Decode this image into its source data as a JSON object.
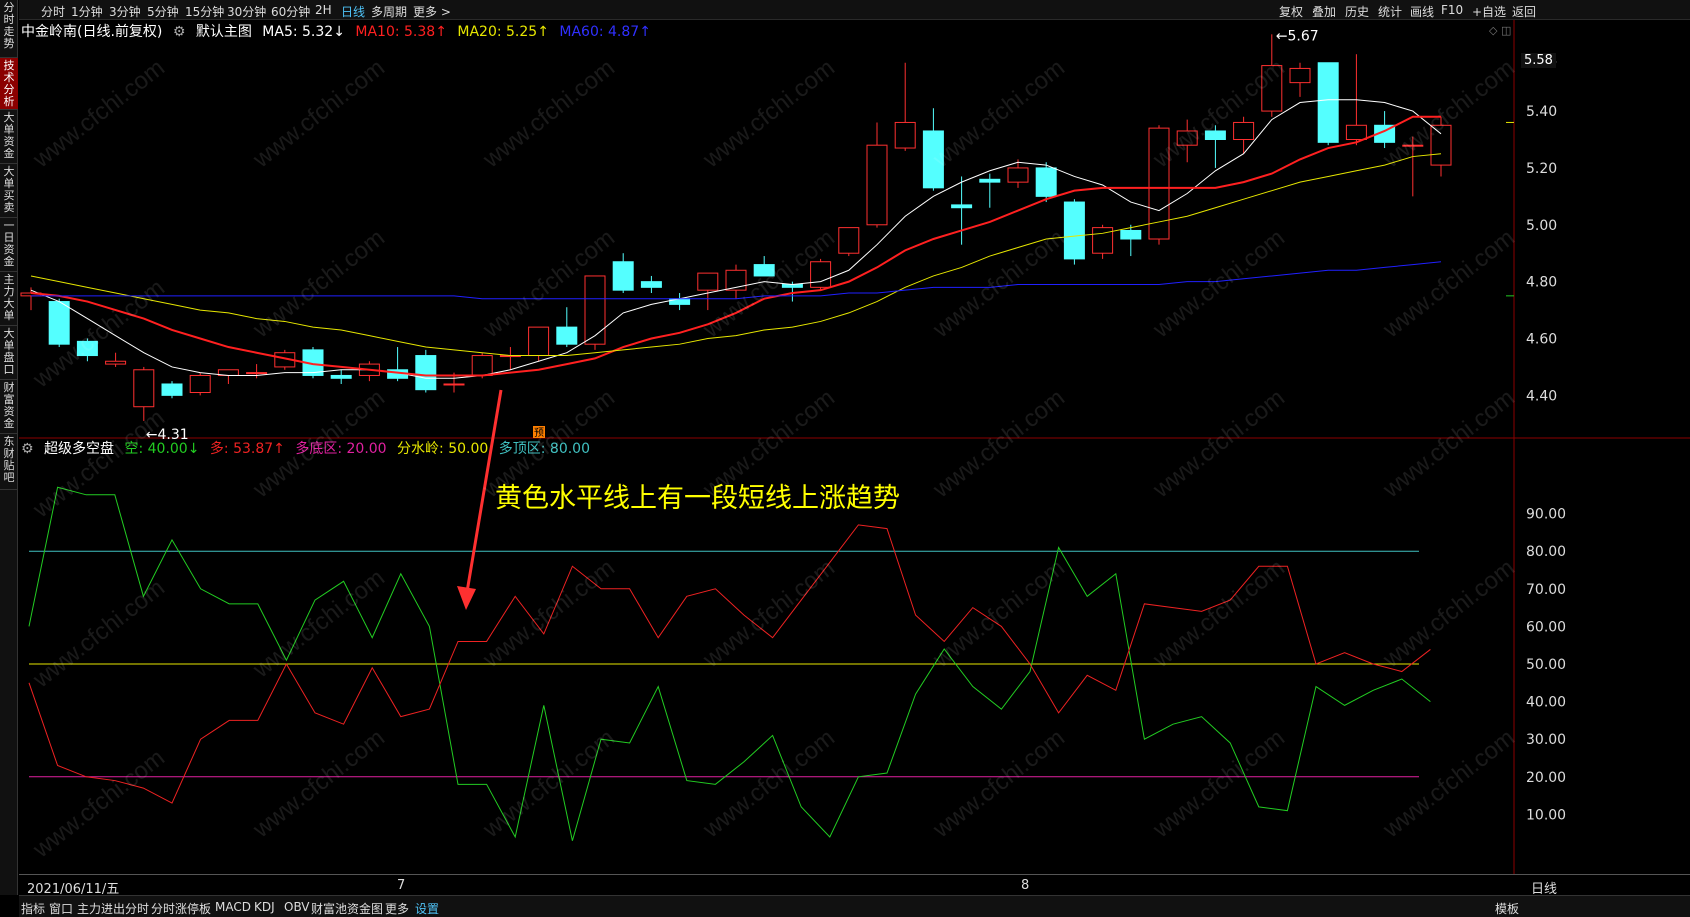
{
  "left_tabs": [
    "分时走势",
    "技术分析",
    "大单资金",
    "大单买卖",
    "一日资金",
    "主力大单",
    "大单盘口",
    "财富资金",
    "东财贴吧"
  ],
  "active_left_tab": "技术分析",
  "top_toolbar": {
    "periods": [
      "分时",
      "1分钟",
      "3分钟",
      "5分钟",
      "15分钟",
      "30分钟",
      "60分钟",
      "2H",
      "日线",
      "多周期",
      "更多 >"
    ],
    "active_period": "日线",
    "right_items": [
      "复权",
      "叠加",
      "历史",
      "统计",
      "画线",
      "F10",
      "+自选",
      "返回"
    ]
  },
  "main_legend": {
    "title": "中金岭南(日线.前复权)",
    "indicator_name": "默认主图",
    "ma5": "MA5: 5.32↓",
    "ma10": "MA10: 5.38↑",
    "ma20": "MA20: 5.25↑",
    "ma60": "MA60: 4.87↑"
  },
  "sub_legend": {
    "name": "超级多空盘",
    "kong": "空: 40.00↓",
    "duo": "多: 53.87↑",
    "duodiqu": "多底区: 20.00",
    "fenshuiling": "分水岭: 50.00",
    "duodingqu": "多顶区: 80.00"
  },
  "price_axis_labels": [
    "5.58",
    "5.40",
    "5.20",
    "5.00",
    "4.80",
    "4.60",
    "4.40"
  ],
  "sub_axis_labels": [
    "90.00",
    "80.00",
    "70.00",
    "60.00",
    "50.00",
    "40.00",
    "30.00",
    "20.00",
    "10.00"
  ],
  "annotations": {
    "high_label": "5.67",
    "low_label": "4.31",
    "yu_badge": "预",
    "note": "黄色水平线上有一段短线上涨趋势"
  },
  "date_axis": {
    "first": "2021/06/11/五",
    "month7": "7",
    "month8": "8",
    "period": "日线"
  },
  "bottom_tabs": [
    "指标",
    "窗口",
    "主力进出分时",
    "分时涨停板",
    "MACD",
    "KDJ",
    "OBV",
    "财富池资金图",
    "更多",
    "设置"
  ],
  "bottom_active": "设置",
  "bottom_right": "模板",
  "watermark": "www.cfchi.com",
  "colors": {
    "up": "#ff3030",
    "down": "#54ffff",
    "ma5": "#ffffff",
    "ma10": "#ff2020",
    "ma20": "#e6e600",
    "ma60": "#2020ff",
    "kong_line": "#22cc22",
    "duo_line": "#ee2222",
    "line80": "#40c0c0",
    "line50": "#e6e600",
    "line20": "#e020a0"
  },
  "chart_data": [
    {
      "type": "candlestick",
      "title": "中金岭南(日线.前复权)",
      "ylim": [
        4.25,
        5.65
      ],
      "candles": [
        {
          "o": 4.75,
          "h": 4.78,
          "l": 4.7,
          "c": 4.76
        },
        {
          "o": 4.73,
          "h": 4.74,
          "l": 4.57,
          "c": 4.58
        },
        {
          "o": 4.59,
          "h": 4.6,
          "l": 4.52,
          "c": 4.54
        },
        {
          "o": 4.51,
          "h": 4.55,
          "l": 4.5,
          "c": 4.52
        },
        {
          "o": 4.36,
          "h": 4.5,
          "l": 4.31,
          "c": 4.49
        },
        {
          "o": 4.44,
          "h": 4.45,
          "l": 4.39,
          "c": 4.4
        },
        {
          "o": 4.41,
          "h": 4.48,
          "l": 4.4,
          "c": 4.47
        },
        {
          "o": 4.47,
          "h": 4.49,
          "l": 4.44,
          "c": 4.49
        },
        {
          "o": 4.48,
          "h": 4.51,
          "l": 4.46,
          "c": 4.48
        },
        {
          "o": 4.5,
          "h": 4.56,
          "l": 4.49,
          "c": 4.55
        },
        {
          "o": 4.56,
          "h": 4.57,
          "l": 4.46,
          "c": 4.47
        },
        {
          "o": 4.47,
          "h": 4.49,
          "l": 4.44,
          "c": 4.46
        },
        {
          "o": 4.47,
          "h": 4.52,
          "l": 4.45,
          "c": 4.51
        },
        {
          "o": 4.49,
          "h": 4.57,
          "l": 4.45,
          "c": 4.46
        },
        {
          "o": 4.54,
          "h": 4.56,
          "l": 4.41,
          "c": 4.42
        },
        {
          "o": 4.44,
          "h": 4.48,
          "l": 4.41,
          "c": 4.44
        },
        {
          "o": 4.47,
          "h": 4.55,
          "l": 4.46,
          "c": 4.54
        },
        {
          "o": 4.54,
          "h": 4.57,
          "l": 4.49,
          "c": 4.54
        },
        {
          "o": 4.54,
          "h": 4.64,
          "l": 4.52,
          "c": 4.64
        },
        {
          "o": 4.64,
          "h": 4.71,
          "l": 4.57,
          "c": 4.58
        },
        {
          "o": 4.58,
          "h": 4.82,
          "l": 4.56,
          "c": 4.82
        },
        {
          "o": 4.87,
          "h": 4.9,
          "l": 4.76,
          "c": 4.77
        },
        {
          "o": 4.8,
          "h": 4.82,
          "l": 4.76,
          "c": 4.78
        },
        {
          "o": 4.74,
          "h": 4.76,
          "l": 4.7,
          "c": 4.72
        },
        {
          "o": 4.77,
          "h": 4.83,
          "l": 4.7,
          "c": 4.83
        },
        {
          "o": 4.77,
          "h": 4.86,
          "l": 4.74,
          "c": 4.84
        },
        {
          "o": 4.86,
          "h": 4.89,
          "l": 4.82,
          "c": 4.82
        },
        {
          "o": 4.79,
          "h": 4.8,
          "l": 4.73,
          "c": 4.78
        },
        {
          "o": 4.78,
          "h": 4.88,
          "l": 4.77,
          "c": 4.87
        },
        {
          "o": 4.9,
          "h": 4.99,
          "l": 4.89,
          "c": 4.99
        },
        {
          "o": 5.0,
          "h": 5.36,
          "l": 4.99,
          "c": 5.28
        },
        {
          "o": 5.27,
          "h": 5.57,
          "l": 5.26,
          "c": 5.36
        },
        {
          "o": 5.33,
          "h": 5.41,
          "l": 5.12,
          "c": 5.13
        },
        {
          "o": 5.07,
          "h": 5.17,
          "l": 4.93,
          "c": 5.06
        },
        {
          "o": 5.16,
          "h": 5.18,
          "l": 5.06,
          "c": 5.15
        },
        {
          "o": 5.15,
          "h": 5.23,
          "l": 5.13,
          "c": 5.2
        },
        {
          "o": 5.2,
          "h": 5.22,
          "l": 5.08,
          "c": 5.1
        },
        {
          "o": 5.08,
          "h": 5.09,
          "l": 4.86,
          "c": 4.88
        },
        {
          "o": 4.9,
          "h": 5.0,
          "l": 4.88,
          "c": 4.99
        },
        {
          "o": 4.98,
          "h": 5.0,
          "l": 4.89,
          "c": 4.95
        },
        {
          "o": 4.95,
          "h": 5.35,
          "l": 4.93,
          "c": 5.34
        },
        {
          "o": 5.28,
          "h": 5.37,
          "l": 5.22,
          "c": 5.33
        },
        {
          "o": 5.33,
          "h": 5.35,
          "l": 5.2,
          "c": 5.3
        },
        {
          "o": 5.3,
          "h": 5.38,
          "l": 5.25,
          "c": 5.36
        },
        {
          "o": 5.4,
          "h": 5.67,
          "l": 5.38,
          "c": 5.56
        },
        {
          "o": 5.5,
          "h": 5.57,
          "l": 5.45,
          "c": 5.55
        },
        {
          "o": 5.57,
          "h": 5.57,
          "l": 5.28,
          "c": 5.29
        },
        {
          "o": 5.3,
          "h": 5.6,
          "l": 5.28,
          "c": 5.35
        },
        {
          "o": 5.35,
          "h": 5.4,
          "l": 5.27,
          "c": 5.29
        },
        {
          "o": 5.28,
          "h": 5.31,
          "l": 5.1,
          "c": 5.28
        },
        {
          "o": 5.21,
          "h": 5.38,
          "l": 5.17,
          "c": 5.35
        }
      ],
      "series": [
        {
          "name": "MA5",
          "values": [
            4.77,
            4.73,
            4.67,
            4.61,
            4.55,
            4.5,
            4.48,
            4.47,
            4.47,
            4.48,
            4.48,
            4.49,
            4.49,
            4.48,
            4.46,
            4.46,
            4.47,
            4.49,
            4.52,
            4.55,
            4.61,
            4.69,
            4.72,
            4.74,
            4.76,
            4.78,
            4.8,
            4.79,
            4.8,
            4.84,
            4.93,
            5.03,
            5.1,
            5.15,
            5.19,
            5.22,
            5.21,
            5.17,
            5.14,
            5.08,
            5.05,
            5.11,
            5.19,
            5.25,
            5.37,
            5.43,
            5.44,
            5.44,
            5.43,
            5.4,
            5.32
          ]
        },
        {
          "name": "MA10",
          "values": [
            4.76,
            4.75,
            4.73,
            4.7,
            4.67,
            4.63,
            4.6,
            4.57,
            4.55,
            4.53,
            4.51,
            4.5,
            4.49,
            4.48,
            4.47,
            4.47,
            4.47,
            4.48,
            4.49,
            4.51,
            4.53,
            4.57,
            4.6,
            4.62,
            4.65,
            4.69,
            4.74,
            4.76,
            4.77,
            4.8,
            4.85,
            4.91,
            4.95,
            4.98,
            5.01,
            5.05,
            5.09,
            5.12,
            5.13,
            5.13,
            5.13,
            5.13,
            5.13,
            5.15,
            5.18,
            5.23,
            5.27,
            5.29,
            5.33,
            5.38,
            5.38
          ]
        },
        {
          "name": "MA20",
          "values": [
            4.82,
            4.8,
            4.78,
            4.76,
            4.74,
            4.72,
            4.7,
            4.69,
            4.67,
            4.66,
            4.64,
            4.63,
            4.61,
            4.59,
            4.57,
            4.56,
            4.55,
            4.54,
            4.54,
            4.54,
            4.55,
            4.56,
            4.57,
            4.58,
            4.6,
            4.61,
            4.63,
            4.64,
            4.66,
            4.69,
            4.73,
            4.78,
            4.82,
            4.85,
            4.89,
            4.92,
            4.95,
            4.96,
            4.97,
            4.99,
            5.01,
            5.03,
            5.06,
            5.09,
            5.12,
            5.15,
            5.17,
            5.19,
            5.21,
            5.24,
            5.25
          ]
        },
        {
          "name": "MA60",
          "values": [
            4.75,
            4.75,
            4.75,
            4.75,
            4.75,
            4.75,
            4.75,
            4.75,
            4.75,
            4.75,
            4.75,
            4.75,
            4.75,
            4.75,
            4.75,
            4.75,
            4.74,
            4.74,
            4.74,
            4.74,
            4.74,
            4.74,
            4.74,
            4.74,
            4.74,
            4.74,
            4.75,
            4.75,
            4.75,
            4.76,
            4.76,
            4.77,
            4.78,
            4.78,
            4.78,
            4.79,
            4.79,
            4.79,
            4.79,
            4.79,
            4.79,
            4.8,
            4.8,
            4.81,
            4.82,
            4.83,
            4.84,
            4.84,
            4.85,
            4.86,
            4.87
          ]
        }
      ]
    },
    {
      "type": "line",
      "title": "超级多空盘",
      "ylim": [
        0,
        100
      ],
      "series": [
        {
          "name": "空",
          "values": [
            60,
            97,
            95,
            95,
            68,
            83,
            70,
            66,
            66,
            51,
            67,
            72,
            57,
            74,
            60,
            18,
            18,
            4,
            39,
            3,
            30,
            29,
            44,
            19,
            18,
            24,
            31,
            12,
            4,
            20,
            21,
            42,
            54,
            44,
            38,
            48,
            81,
            68,
            74,
            30,
            34,
            36,
            29,
            12,
            11,
            44,
            39,
            43,
            46,
            40
          ]
        },
        {
          "name": "多",
          "values": [
            45,
            23,
            20,
            19,
            17,
            13,
            30,
            35,
            35,
            50,
            37,
            34,
            49,
            36,
            38,
            56,
            56,
            68,
            58,
            76,
            70,
            70,
            57,
            68,
            70,
            63,
            57,
            67,
            77,
            87,
            86,
            63,
            56,
            65,
            60,
            50,
            37,
            47,
            43,
            66,
            65,
            64,
            67,
            76,
            76,
            50,
            53,
            50,
            48,
            53.87
          ]
        }
      ],
      "reference_lines": [
        80,
        50,
        20
      ]
    }
  ]
}
